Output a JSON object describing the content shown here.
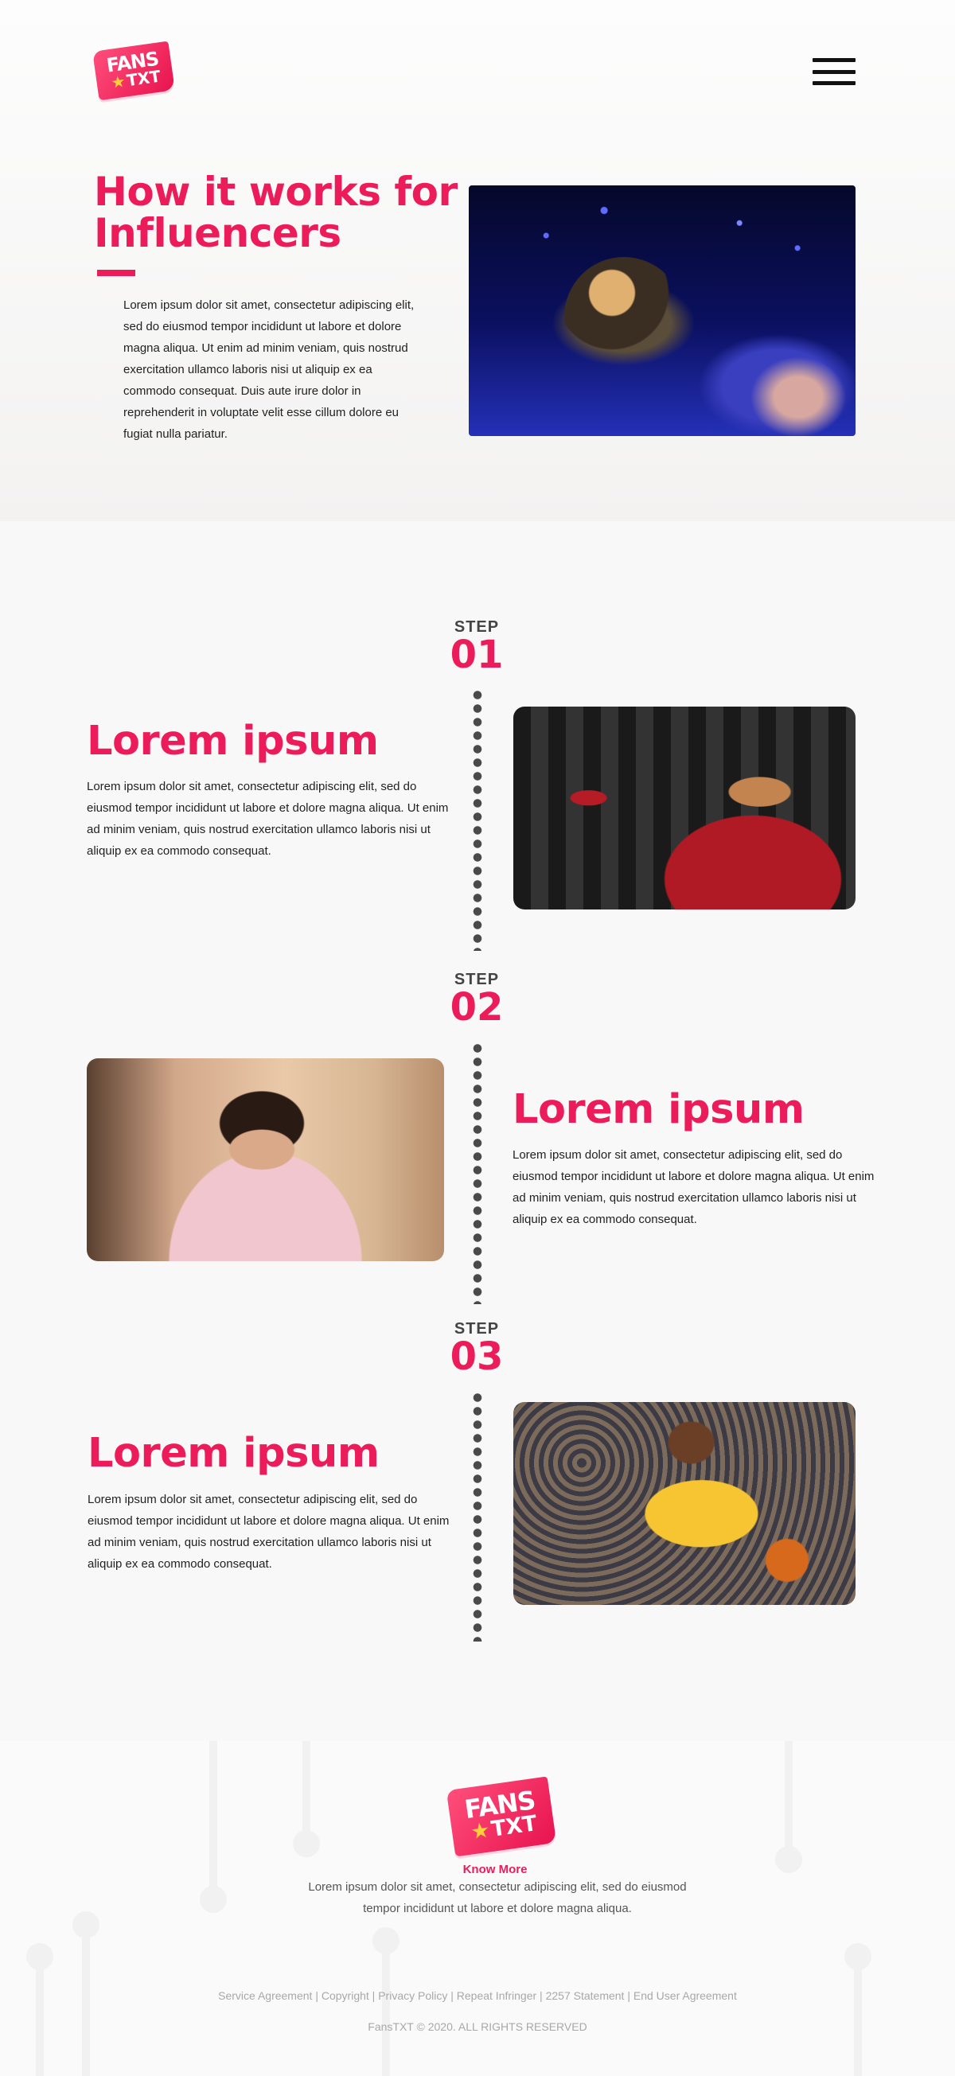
{
  "header": {
    "logo_top": "FANS",
    "logo_bottom": "TXT",
    "menu_icon": "hamburger-menu-icon"
  },
  "hero": {
    "title": "How it works for Influencers",
    "body": "Lorem ipsum dolor sit amet, consectetur adipiscing elit, sed do eiusmod tempor incididunt ut labore et dolore magna aliqua. Ut enim ad minim veniam, quis nostrud exercitation ullamco laboris nisi ut aliquip ex ea commodo consequat. Duis aute irure dolor in reprehenderit in voluptate velit esse cillum dolore eu fugiat nulla pariatur."
  },
  "steps": [
    {
      "label": "STEP",
      "number": "01",
      "title": "Lorem ipsum",
      "body": "Lorem ipsum dolor sit amet, consectetur adipiscing elit, sed do eiusmod tempor incididunt ut labore et dolore magna aliqua. Ut enim ad minim veniam, quis nostrud exercitation ullamco laboris nisi ut aliquip ex ea commodo consequat."
    },
    {
      "label": "STEP",
      "number": "02",
      "title": "Lorem ipsum",
      "body": "Lorem ipsum dolor sit amet, consectetur adipiscing elit, sed do eiusmod tempor incididunt ut labore et dolore magna aliqua. Ut enim ad minim veniam, quis nostrud exercitation ullamco laboris nisi ut aliquip ex ea commodo consequat."
    },
    {
      "label": "STEP",
      "number": "03",
      "title": "Lorem ipsum",
      "body": "Lorem ipsum dolor sit amet, consectetur adipiscing elit, sed do eiusmod tempor incididunt ut labore et dolore magna aliqua. Ut enim ad minim veniam, quis nostrud exercitation ullamco laboris nisi ut aliquip ex ea commodo consequat."
    }
  ],
  "footer": {
    "logo_top": "FANS",
    "logo_bottom": "TXT",
    "know_more": "Know More",
    "body": "Lorem ipsum dolor sit amet, consectetur adipiscing elit, sed do eiusmod tempor incididunt ut labore et dolore magna aliqua.",
    "links": [
      "Service Agreement",
      "Copyright",
      "Privacy Policy",
      "Repeat Infringer",
      "2257 Statement",
      "End User Agreement"
    ],
    "separator": " | ",
    "copyright": "FansTXT © 2020. ALL RIGHTS RESERVED"
  },
  "colors": {
    "accent": "#ec1c5b",
    "text": "#222222",
    "muted": "#a8a8a8",
    "background": "#f8f8f8"
  }
}
